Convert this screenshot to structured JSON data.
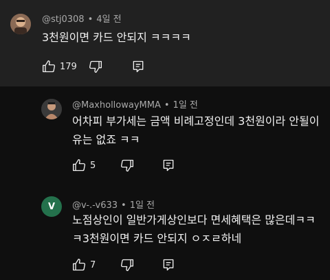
{
  "comments": [
    {
      "handle": "@stj0308",
      "sep": "•",
      "time": "4일 전",
      "lines": [
        "3천원이면 카드 안되지 ㅋㅋㅋㅋ"
      ],
      "likes": "179"
    },
    {
      "handle": "@MaxhollowayMMA",
      "sep": "•",
      "time": "1일 전",
      "lines": [
        "어차피 부가세는 금액 비례고정인데 3천원이라 안될이",
        "유는 없죠 ㅋㅋ"
      ],
      "likes": "5"
    },
    {
      "handle": "@v-.-v633",
      "sep": "•",
      "time": "1일 전",
      "avatar_letter": "V",
      "avatar_color": "#24714c",
      "lines": [
        "노점상인이 일반가게상인보다 면세혜택은 많은데ㅋㅋ",
        "ㅋ3천원이면 카드 안되지 ㅇㅈㄹ하네"
      ],
      "likes": "7"
    }
  ],
  "icons": [
    "thumb-up-icon",
    "thumb-down-icon",
    "reply-icon"
  ],
  "colors": {
    "top_background": "#212121",
    "background": "#0f0f0f",
    "meta_text": "#aaaaaa"
  }
}
